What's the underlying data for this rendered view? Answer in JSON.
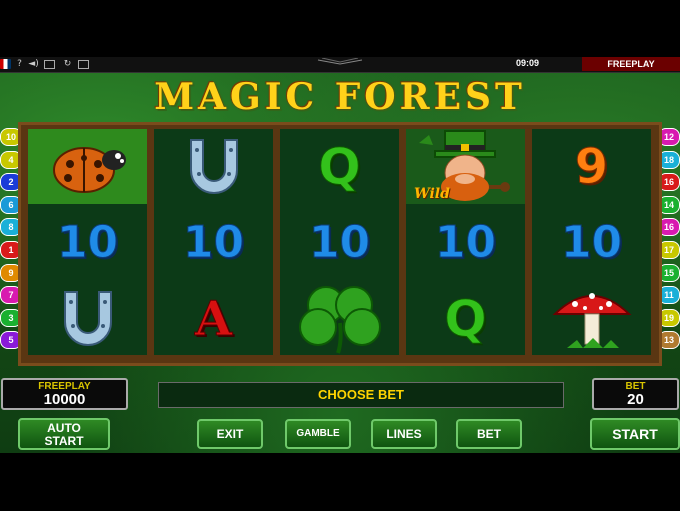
{
  "topbar": {
    "icons": [
      "flag-icon",
      "help-icon",
      "sound-icon",
      "screen-icon",
      "refresh-icon",
      "fullscreen-icon"
    ],
    "help_glyph": "?",
    "clock": "09:09",
    "mode_label": "FREEPLAY"
  },
  "game": {
    "title": "MAGIC FOREST"
  },
  "paylines": {
    "left": [
      "10",
      "4",
      "2",
      "6",
      "8",
      "1",
      "9",
      "7",
      "3",
      "5"
    ],
    "right": [
      "12",
      "18",
      "16",
      "14",
      "16",
      "17",
      "15",
      "11",
      "19",
      "13"
    ]
  },
  "reels": {
    "columns": [
      [
        "ladybug",
        "10",
        "horseshoe"
      ],
      [
        "horseshoe",
        "10",
        "A"
      ],
      [
        "Q",
        "10",
        "clover"
      ],
      [
        "leprechaun-wild",
        "10",
        "Q"
      ],
      [
        "9",
        "10",
        "mushroom"
      ]
    ],
    "ten": "10",
    "q": "Q",
    "a": "A",
    "nine": "9",
    "wild_label": "Wild"
  },
  "panel": {
    "credit_label": "FREEPLAY",
    "credit_value": "10000",
    "message": "CHOOSE BET",
    "bet_label": "BET",
    "bet_value": "20"
  },
  "buttons": {
    "auto_start_line1": "AUTO",
    "auto_start_line2": "START",
    "exit": "EXIT",
    "gamble": "GAMBLE",
    "lines": "LINES",
    "bet": "BET",
    "start": "START"
  },
  "colors": {
    "chip_colors_left": [
      "#c8c800",
      "#c8c800",
      "#1a3bd8",
      "#1a9ad8",
      "#1ab0d8",
      "#d81a1a",
      "#e08a00",
      "#d81ab0",
      "#1ab030",
      "#8a1ad8"
    ],
    "chip_colors_right": [
      "#d81ab0",
      "#1ab0d8",
      "#d81a1a",
      "#1ab030",
      "#d81ab0",
      "#c8c800",
      "#1ab030",
      "#1ab0d8",
      "#c8c800",
      "#b07a30"
    ]
  }
}
